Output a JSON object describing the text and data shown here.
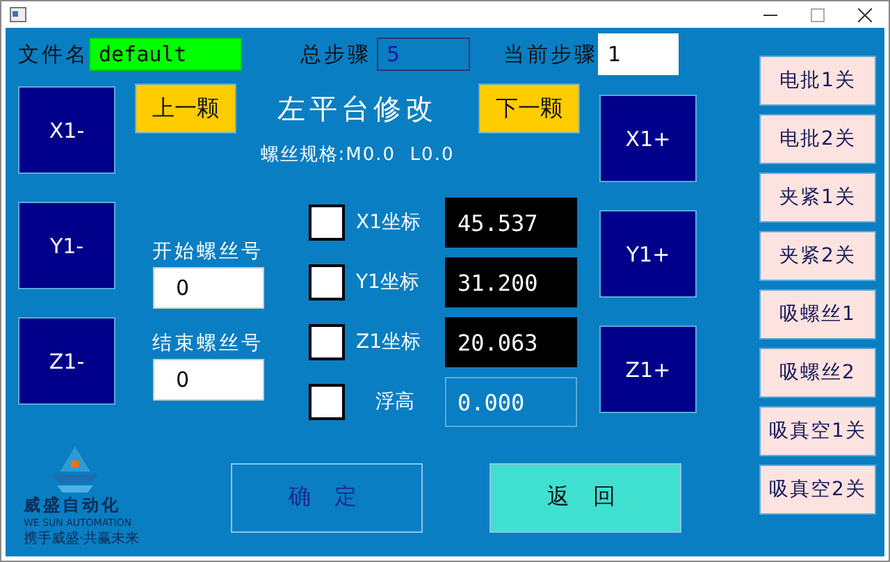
{
  "file_name": {
    "label": "文件名",
    "value": "default"
  },
  "total_steps": {
    "label": "总步骤",
    "value": "5"
  },
  "current_step": {
    "label": "当前步骤",
    "value": "1"
  },
  "prev_button": "上一颗",
  "title": "左平台修改",
  "next_button": "下一颗",
  "screw_spec": "螺丝规格:M0.0  L0.0",
  "jog_minus": [
    "X1-",
    "Y1-",
    "Z1-"
  ],
  "jog_plus": [
    "X1+",
    "Y1+",
    "Z1+"
  ],
  "start_screw": {
    "label": "开始螺丝号",
    "value": "0"
  },
  "end_screw": {
    "label": "结束螺丝号",
    "value": "0"
  },
  "axes": [
    {
      "kind": "coordinate",
      "label": "X1坐标",
      "value": "45.537",
      "checked": false
    },
    {
      "kind": "coordinate",
      "label": "Y1坐标",
      "value": "31.200",
      "checked": false
    },
    {
      "kind": "coordinate",
      "label": "Z1坐标",
      "value": "20.063",
      "checked": false
    },
    {
      "kind": "float",
      "label": "浮高",
      "value": "0.000",
      "checked": false
    }
  ],
  "toggles": [
    "电批1关",
    "电批2关",
    "夹紧1关",
    "夹紧2关",
    "吸螺丝1",
    "吸螺丝2",
    "吸真空1关",
    "吸真空2关"
  ],
  "logo": {
    "name": "威盛自动化",
    "tagline": "WE SUN AUTOMATION",
    "slogan": "携手威盛·共赢未来"
  },
  "confirm_button": "确 定",
  "back_button": "返 回"
}
